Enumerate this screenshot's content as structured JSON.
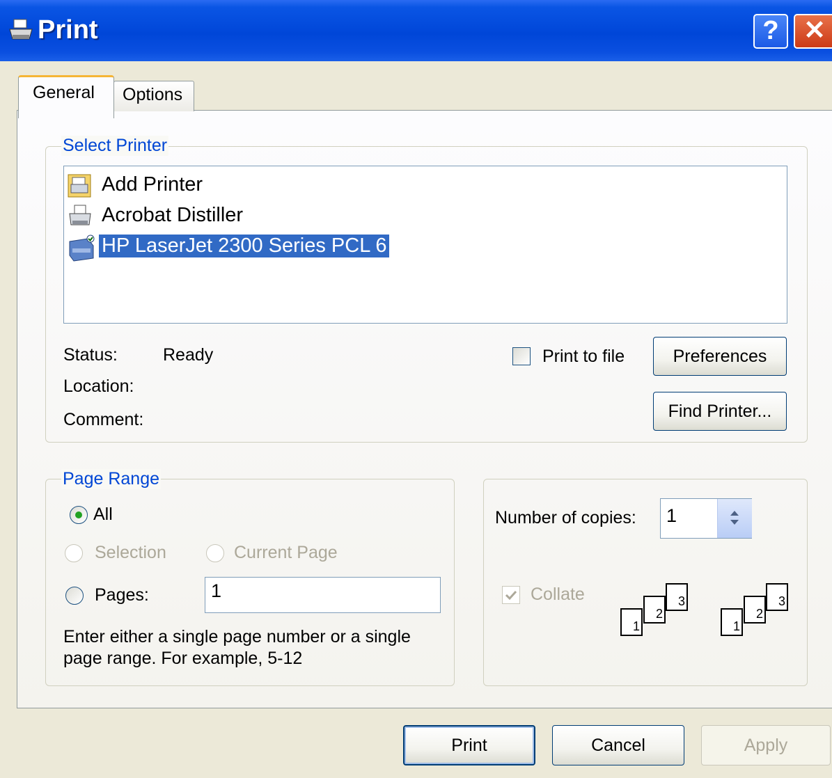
{
  "window": {
    "title": "Print",
    "help_label": "?",
    "close_label": "✕"
  },
  "tabs": [
    {
      "label": "General"
    },
    {
      "label": "Options"
    }
  ],
  "select_printer": {
    "legend": "Select Printer",
    "printers": [
      {
        "label": "Add Printer",
        "icon": "add-printer-icon"
      },
      {
        "label": "Acrobat Distiller",
        "icon": "printer-icon"
      },
      {
        "label": "HP LaserJet 2300 Series PCL 6",
        "icon": "default-printer-icon",
        "selected": true
      }
    ],
    "status_label": "Status:",
    "status_value": "Ready",
    "location_label": "Location:",
    "comment_label": "Comment:",
    "print_to_file_label": "Print to file",
    "print_to_file_checked": false,
    "preferences_label": "Preferences",
    "find_printer_label": "Find Printer..."
  },
  "page_range": {
    "legend": "Page Range",
    "all_label": "All",
    "selection_label": "Selection",
    "current_page_label": "Current Page",
    "pages_label": "Pages:",
    "pages_value": "1",
    "selected_option": "All",
    "help_text_line1": "Enter either a single page number or a single",
    "help_text_line2": "page range.  For example, 5-12"
  },
  "copies": {
    "label": "Number of copies:",
    "value": "1",
    "collate_label": "Collate",
    "collate_checked": true,
    "collate_pages": [
      "1",
      "2",
      "3"
    ]
  },
  "footer": {
    "print_label": "Print",
    "cancel_label": "Cancel",
    "apply_label": "Apply"
  },
  "colors": {
    "titlebar": "#0046d8",
    "accent": "#0046d5",
    "selection": "#316ac5",
    "face": "#ece9d8"
  }
}
